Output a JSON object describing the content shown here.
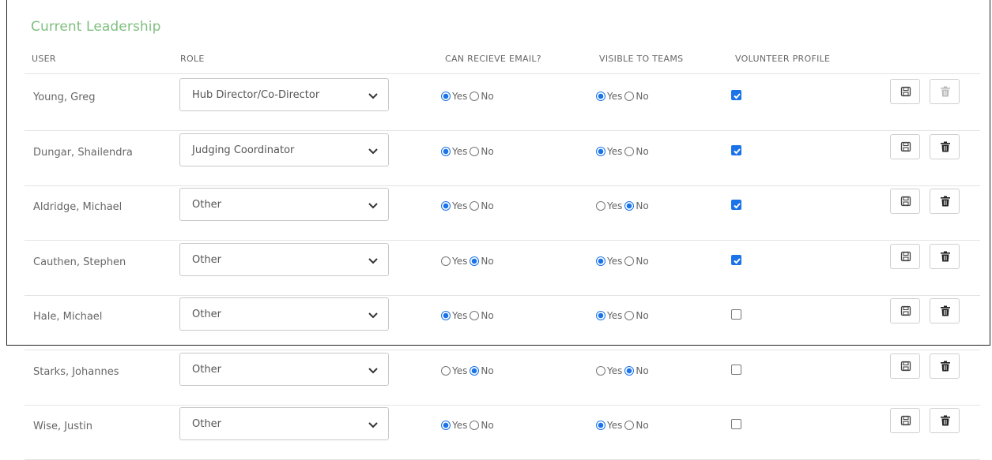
{
  "section_title": "Current Leadership",
  "columns": {
    "user": "USER",
    "role": "ROLE",
    "email": "CAN RECIEVE EMAIL?",
    "visible": "VISIBLE TO TEAMS",
    "volunteer": "VOLUNTEER PROFILE"
  },
  "radio_labels": {
    "yes": "Yes",
    "no": "No"
  },
  "icons": {
    "save": "floppy-disk-icon",
    "delete": "trash-icon",
    "dropdown": "chevron-down-icon",
    "check": "checkmark-icon"
  },
  "colors": {
    "heading": "#7fbf7f",
    "accent": "#1a73e8"
  },
  "rows": [
    {
      "user": "Young, Greg",
      "role": "Hub Director/Co-Director",
      "email": "yes",
      "visible": "yes",
      "volunteer": true,
      "delete_enabled": false
    },
    {
      "user": "Dungar, Shailendra",
      "role": "Judging Coordinator",
      "email": "yes",
      "visible": "yes",
      "volunteer": true,
      "delete_enabled": true
    },
    {
      "user": "Aldridge, Michael",
      "role": "Other",
      "email": "yes",
      "visible": "no",
      "volunteer": true,
      "delete_enabled": true
    },
    {
      "user": "Cauthen, Stephen",
      "role": "Other",
      "email": "no",
      "visible": "yes",
      "volunteer": true,
      "delete_enabled": true
    },
    {
      "user": "Hale, Michael",
      "role": "Other",
      "email": "yes",
      "visible": "yes",
      "volunteer": false,
      "delete_enabled": true
    },
    {
      "user": "Starks, Johannes",
      "role": "Other",
      "email": "no",
      "visible": "no",
      "volunteer": false,
      "delete_enabled": true
    },
    {
      "user": "Wise, Justin",
      "role": "Other",
      "email": "yes",
      "visible": "yes",
      "volunteer": false,
      "delete_enabled": true
    }
  ]
}
